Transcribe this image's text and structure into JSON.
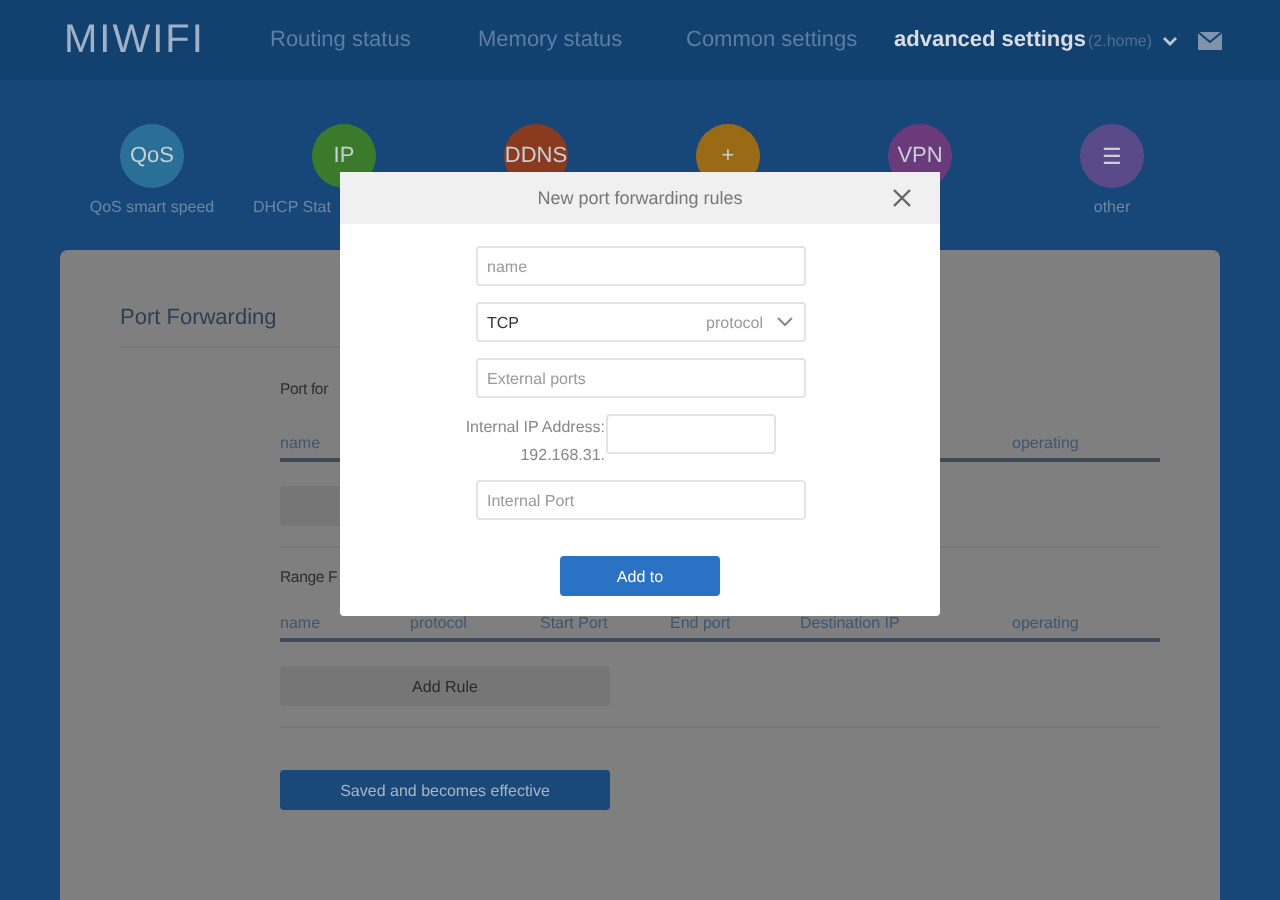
{
  "header": {
    "logo": "MIWIFI",
    "nav": [
      {
        "label": "Routing status",
        "selected": false
      },
      {
        "label": "Memory status",
        "selected": false
      },
      {
        "label": "Common settings",
        "selected": false
      },
      {
        "label": "advanced settings",
        "selected": true
      }
    ],
    "router": "(2.home)"
  },
  "shortcuts": [
    {
      "glyph": "QoS",
      "color": "#2a6f95",
      "label": "QoS smart speed"
    },
    {
      "glyph": "IP",
      "color": "#3a7a2a",
      "label": "DHCP Stat"
    },
    {
      "glyph": "DDNS",
      "color": "#8a3a1e"
    },
    {
      "glyph": "+",
      "color": "#9a6a14"
    },
    {
      "glyph": "VPN",
      "color": "#6a3a7a"
    },
    {
      "glyph": "☰",
      "color": "#5a4a8a",
      "label": "other"
    }
  ],
  "page": {
    "title": "Port Forwarding",
    "sections": [
      {
        "heading": "Port for",
        "columns": [
          "name",
          "operating"
        ]
      },
      {
        "heading": "Range F",
        "columns": [
          "name",
          "protocol",
          "Start Port",
          "End port",
          "Destination IP",
          "operating"
        ],
        "button": "Add Rule"
      }
    ],
    "save_button": "Saved and becomes effective"
  },
  "dialog": {
    "title": "New port forwarding rules",
    "fields": [
      {
        "kind": "input",
        "placeholder": "name"
      },
      {
        "kind": "select",
        "value": "TCP",
        "placeholder": "protocol"
      },
      {
        "kind": "input",
        "placeholder": "External ports"
      },
      {
        "kind": "ip",
        "label": "Internal IP Address:",
        "prefix": "192.168.31."
      },
      {
        "kind": "input",
        "placeholder": "Internal Port"
      }
    ],
    "submit": "Add to"
  }
}
